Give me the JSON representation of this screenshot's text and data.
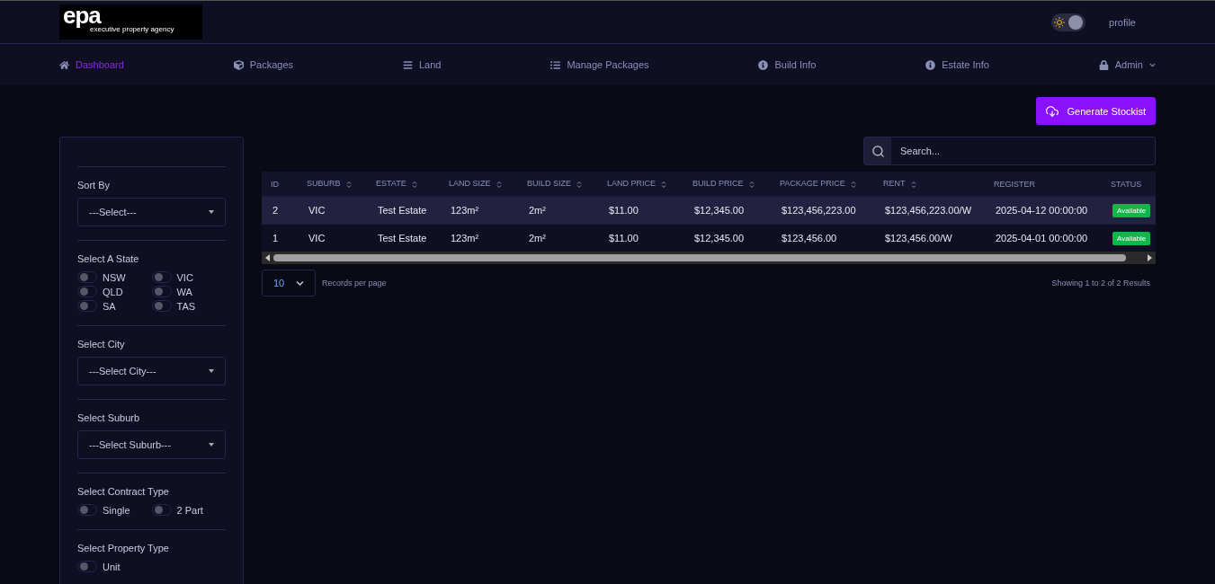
{
  "logo": {
    "mark": "epa",
    "tagline": "executive property agency"
  },
  "header": {
    "profile_alt": "profile",
    "theme_toggle": {
      "on": true
    }
  },
  "nav": [
    {
      "label": "Dashboard",
      "selected": true
    },
    {
      "label": "Packages",
      "selected": false
    },
    {
      "label": "Land",
      "selected": false
    },
    {
      "label": "Manage Packages",
      "selected": false
    },
    {
      "label": "Build Info",
      "selected": false
    },
    {
      "label": "Estate Info",
      "selected": false
    },
    {
      "label": "Admin",
      "selected": false
    }
  ],
  "generate_button": "Generate Stockist",
  "filters": [
    {
      "kind": "select",
      "label": "Sort By",
      "value": "---Select---"
    },
    {
      "kind": "toggles",
      "label": "Select A State",
      "options": [
        {
          "label": "NSW",
          "on": false
        },
        {
          "label": "VIC",
          "on": false
        },
        {
          "label": "QLD",
          "on": false
        },
        {
          "label": "WA",
          "on": false
        },
        {
          "label": "SA",
          "on": false
        },
        {
          "label": "TAS",
          "on": false
        }
      ]
    },
    {
      "kind": "select",
      "label": "Select City",
      "value": "---Select City---"
    },
    {
      "kind": "select",
      "label": "Select Suburb",
      "value": "---Select Suburb---"
    },
    {
      "kind": "toggles",
      "label": "Select Contract Type",
      "options": [
        {
          "label": "Single",
          "on": false
        },
        {
          "label": "2 Part",
          "on": false
        }
      ]
    },
    {
      "kind": "toggles",
      "label": "Select Property Type",
      "options": [
        {
          "label": "Unit",
          "on": false
        }
      ]
    }
  ],
  "search": {
    "placeholder": "Search..."
  },
  "table": {
    "columns": [
      {
        "label": "ID",
        "sortable": false
      },
      {
        "label": "SUBURB",
        "sortable": true
      },
      {
        "label": "ESTATE",
        "sortable": true
      },
      {
        "label": "LAND SIZE",
        "sortable": true
      },
      {
        "label": "BUILD SIZE",
        "sortable": true
      },
      {
        "label": "LAND PRICE",
        "sortable": true
      },
      {
        "label": "BUILD PRICE",
        "sortable": true
      },
      {
        "label": "PACKAGE PRICE",
        "sortable": true
      },
      {
        "label": "RENT",
        "sortable": true
      },
      {
        "label": "REGISTER",
        "sortable": false
      },
      {
        "label": "STATUS",
        "sortable": false
      }
    ],
    "rows": [
      {
        "selected": true,
        "cells": [
          "2",
          "VIC",
          "Test Estate",
          "123m²",
          "2m²",
          "$11.00",
          "$12,345.00",
          "$123,456,223.00",
          "$123,456,223.00/W",
          "2025-04-12 00:00:00"
        ],
        "status": "Available"
      },
      {
        "selected": false,
        "cells": [
          "1",
          "VIC",
          "Test Estate",
          "123m²",
          "2m²",
          "$11.00",
          "$12,345.00",
          "$123,456.00",
          "$123,456.00/W",
          "2025-04-01 00:00:00"
        ],
        "status": "Available"
      }
    ]
  },
  "pagination": {
    "per_page": "10",
    "per_page_label": "Records per page",
    "summary": "Showing 1 to 2 of 2 Results"
  }
}
